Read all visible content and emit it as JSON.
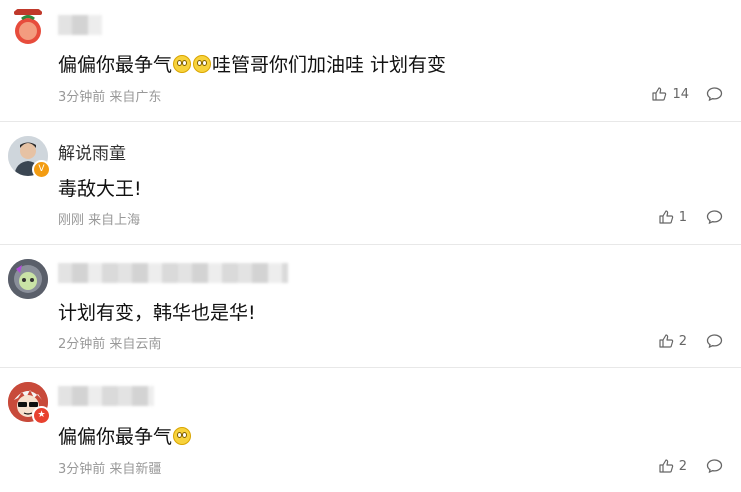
{
  "comments": [
    {
      "username": "",
      "text_parts": [
        "偏偏你最争气",
        "哇管哥你们加油哇 计划有变"
      ],
      "emoji": [
        "sad-face-emoji",
        "sad-face-emoji"
      ],
      "time": "3分钟前",
      "location": "来自广东",
      "likes": "14",
      "avatar_icon": "tomato-avatar-icon"
    },
    {
      "username": "解说雨童",
      "text": "毒敌大王!",
      "time": "刚刚",
      "location": "来自上海",
      "likes": "1",
      "badge": "V",
      "avatar_icon": "man-portrait-avatar-icon"
    },
    {
      "username": "",
      "text": "计划有变，韩华也是华!",
      "time": "2分钟前",
      "location": "来自云南",
      "likes": "2",
      "avatar_icon": "cartoon-avatar-icon"
    },
    {
      "username": "",
      "text": "偏偏你最争气",
      "emoji": [
        "shocked-face-emoji"
      ],
      "time": "3分钟前",
      "location": "来自新疆",
      "likes": "2",
      "badge": "★",
      "avatar_icon": "sunglasses-avatar-icon"
    }
  ],
  "colors": {
    "meta": "#999999",
    "text": "#111111",
    "badge_orange": "#f39c12",
    "badge_red": "#e8412f"
  }
}
